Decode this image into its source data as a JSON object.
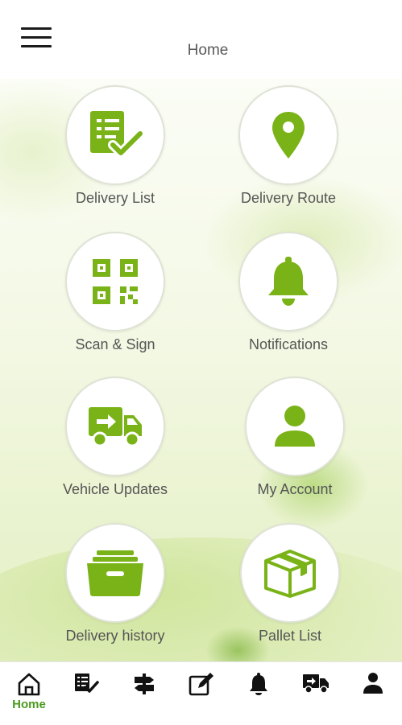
{
  "header": {
    "title": "Home"
  },
  "tiles": [
    {
      "label": "Delivery List",
      "icon": "delivery-list-icon"
    },
    {
      "label": "Delivery Route",
      "icon": "map-pin-icon"
    },
    {
      "label": "Scan & Sign",
      "icon": "qr-code-icon"
    },
    {
      "label": "Notifications",
      "icon": "bell-icon"
    },
    {
      "label": "Vehicle Updates",
      "icon": "truck-icon"
    },
    {
      "label": "My Account",
      "icon": "user-icon"
    },
    {
      "label": "Delivery history",
      "icon": "archive-drawer-icon"
    },
    {
      "label": "Pallet List",
      "icon": "package-box-icon"
    }
  ],
  "bottom_nav": {
    "active": "Home",
    "items": [
      {
        "label": "Home",
        "icon": "home-icon"
      },
      {
        "label": "",
        "icon": "checklist-icon"
      },
      {
        "label": "",
        "icon": "signpost-icon"
      },
      {
        "label": "",
        "icon": "edit-icon"
      },
      {
        "label": "",
        "icon": "bell-icon"
      },
      {
        "label": "",
        "icon": "truck-icon"
      },
      {
        "label": "",
        "icon": "user-icon"
      }
    ]
  },
  "colors": {
    "accent": "#7ab317",
    "nav_active": "#4a9a1e",
    "text": "#555555"
  }
}
